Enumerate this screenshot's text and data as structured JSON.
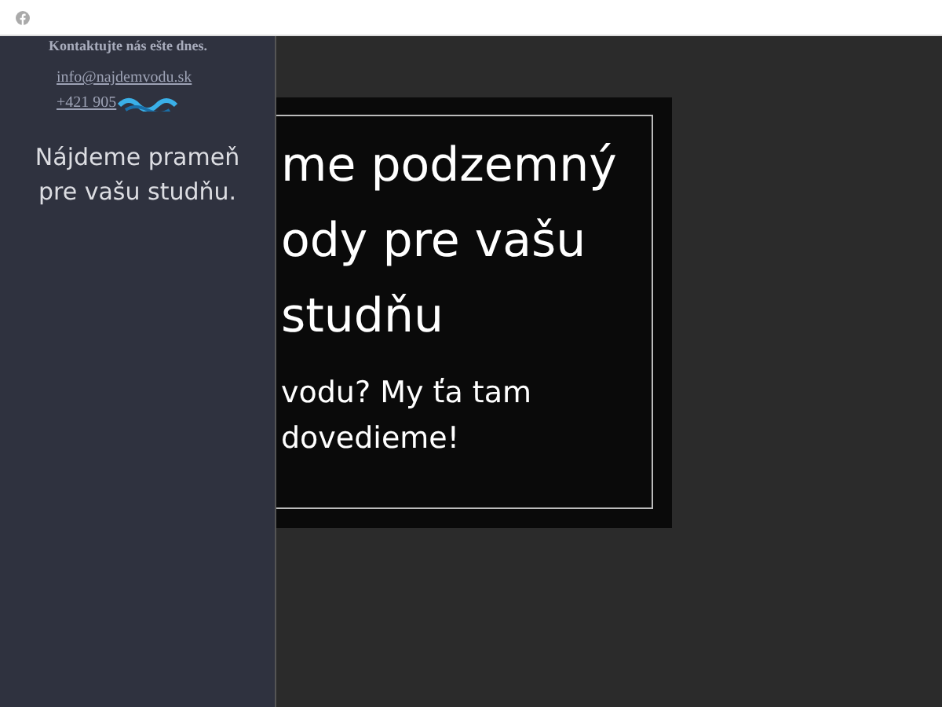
{
  "sidebar": {
    "contact_heading": "Kontaktujte nás ešte dnes.",
    "email": "info@najdemvodu.sk",
    "phone": "+421 905",
    "tagline": "Nájdeme prameň pre vašu studňu."
  },
  "hero": {
    "heading_lines": [
      "me podzemný",
      "ody pre vašu",
      "studňu"
    ],
    "subheading_lines": [
      "vodu? My ťa tam",
      "dovedieme!"
    ]
  }
}
